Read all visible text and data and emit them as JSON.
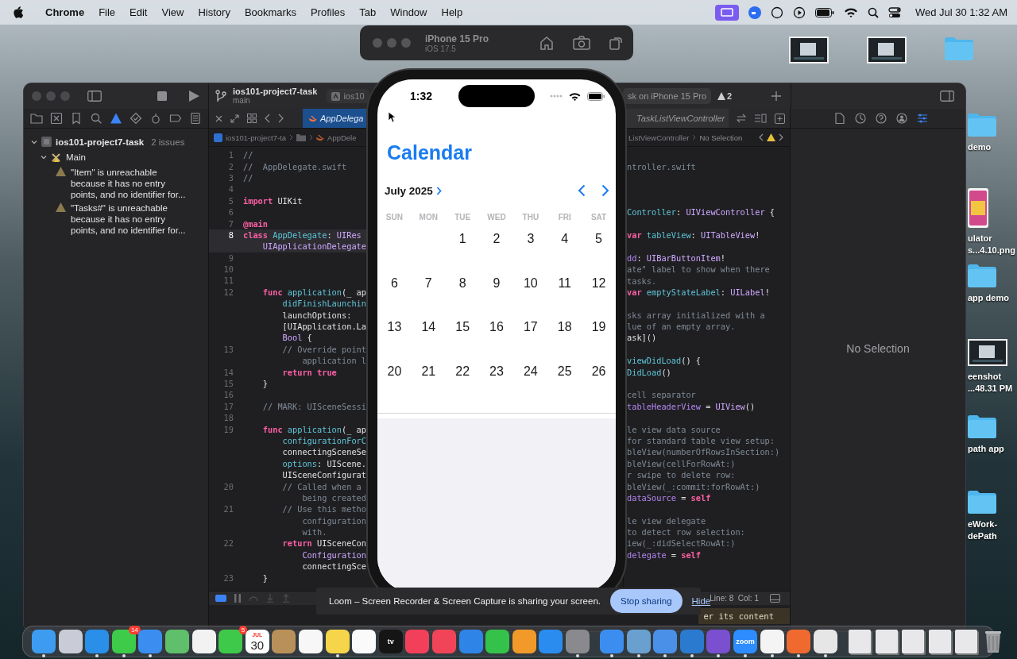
{
  "menu_bar": {
    "app_name": "Chrome",
    "menus": [
      "File",
      "Edit",
      "View",
      "History",
      "Bookmarks",
      "Profiles",
      "Tab",
      "Window",
      "Help"
    ],
    "clock": "Wed Jul 30 1:32 AM"
  },
  "simulator_toolbar": {
    "device": "iPhone 15 Pro",
    "os": "iOS 17.5"
  },
  "desktop_top_row": [
    {
      "kind": "screenshot"
    },
    {
      "kind": "screenshot"
    },
    {
      "kind": "folder"
    }
  ],
  "desktop_column": [
    {
      "kind": "folder",
      "label": "demo"
    },
    {
      "kind": "image",
      "label": "ulator\ns...4.10.png"
    },
    {
      "kind": "folder",
      "label": "app demo"
    },
    {
      "kind": "screenshot",
      "label": "eenshot\n...48.31 PM"
    },
    {
      "kind": "folder",
      "label": "path app"
    },
    {
      "kind": "folder",
      "label": "eWork-\ndePath"
    }
  ],
  "xcode": {
    "project": {
      "title": "ios101-project7-task",
      "branch": "main"
    },
    "scheme_fragment": "ios10",
    "destination_fragment": "sk on iPhone 15 Pro",
    "warning_count": "2",
    "navigator_tabs": [
      {
        "kind": "folder",
        "selected": false
      },
      {
        "kind": "source",
        "selected": false
      },
      {
        "kind": "bookmark",
        "selected": false
      },
      {
        "kind": "search",
        "selected": false
      },
      {
        "kind": "warning",
        "selected": true
      },
      {
        "kind": "test",
        "selected": false
      },
      {
        "kind": "debug",
        "selected": false
      },
      {
        "kind": "breakpoint",
        "selected": false
      },
      {
        "kind": "report",
        "selected": false
      }
    ],
    "issue_tree": {
      "project": "ios101-project7-task",
      "count": "2 issues",
      "expanded": true,
      "children": [
        {
          "name": "Main",
          "expanded": true,
          "children": [
            {
              "message": "\"Item\" is unreachable because it has no entry points, and no identifier for..."
            },
            {
              "message": "\"Tasks#\" is unreachable because it has no entry points, and no identifier for..."
            }
          ]
        }
      ]
    },
    "editor_tabs": [
      {
        "title": "AppDelega",
        "selected": true
      },
      {
        "title": "TaskListViewController",
        "selected": false
      }
    ],
    "left_breadcrumb": [
      "ios101-project7-ta",
      "AppDele"
    ],
    "right_breadcrumb": [
      "ListViewController",
      "No Selection"
    ],
    "left_code": [
      {
        "number": "1",
        "current": false,
        "segments": [
          {
            "kind": "comment",
            "text": "//"
          }
        ]
      },
      {
        "number": "2",
        "current": false,
        "segments": [
          {
            "kind": "comment",
            "text": "//  AppDelegate.swift"
          }
        ]
      },
      {
        "number": "3",
        "current": false,
        "segments": [
          {
            "kind": "comment",
            "text": "//"
          }
        ]
      },
      {
        "number": "4",
        "current": false
      },
      {
        "number": "5",
        "current": false,
        "segments": [
          {
            "kind": "keyword",
            "text": "import"
          },
          {
            "kind": "plain",
            "text": " UIKit"
          }
        ]
      },
      {
        "number": "6",
        "current": false
      },
      {
        "number": "7",
        "current": false,
        "segments": [
          {
            "kind": "keyword",
            "text": "@main"
          }
        ]
      },
      {
        "number": "8",
        "current": true,
        "segments": [
          {
            "kind": "keyword",
            "text": "class"
          },
          {
            "kind": "name",
            "text": " AppDelegate"
          },
          {
            "kind": "plain",
            "text": ": "
          },
          {
            "kind": "type",
            "text": "UIRes"
          }
        ]
      },
      {
        "current": true,
        "segments": [
          {
            "kind": "type",
            "text": "    UIApplicationDelegate"
          }
        ]
      },
      {
        "number": "9",
        "current": false
      },
      {
        "number": "10",
        "current": false
      },
      {
        "number": "11",
        "current": false
      },
      {
        "number": "12",
        "current": false,
        "segments": [
          {
            "kind": "keyword",
            "text": "    func"
          },
          {
            "kind": "name",
            "text": " application"
          },
          {
            "kind": "plain",
            "text": "(_ ap"
          }
        ]
      },
      {
        "current": false,
        "segments": [
          {
            "kind": "name",
            "text": "        didFinishLaunchin"
          }
        ]
      },
      {
        "current": false,
        "segments": [
          {
            "kind": "plain",
            "text": "        launchOptions:"
          }
        ]
      },
      {
        "current": false,
        "segments": [
          {
            "kind": "plain",
            "text": "        [UIApplication.La"
          }
        ]
      },
      {
        "current": false,
        "segments": [
          {
            "kind": "type",
            "text": "        Bool"
          },
          {
            "kind": "plain",
            "text": " {"
          }
        ]
      },
      {
        "number": "13",
        "current": false,
        "segments": [
          {
            "kind": "comment",
            "text": "        // Override point"
          }
        ]
      },
      {
        "current": false,
        "segments": [
          {
            "kind": "comment",
            "text": "            application l"
          }
        ]
      },
      {
        "number": "14",
        "current": false,
        "segments": [
          {
            "kind": "keyword",
            "text": "        return true"
          }
        ]
      },
      {
        "number": "15",
        "current": false,
        "segments": [
          {
            "kind": "plain",
            "text": "    }"
          }
        ]
      },
      {
        "number": "16",
        "current": false
      },
      {
        "number": "17",
        "current": false,
        "segments": [
          {
            "kind": "comment",
            "text": "    // MARK: UISceneSessi"
          }
        ]
      },
      {
        "number": "18",
        "current": false
      },
      {
        "number": "19",
        "current": false,
        "segments": [
          {
            "kind": "keyword",
            "text": "    func"
          },
          {
            "kind": "name",
            "text": " application"
          },
          {
            "kind": "plain",
            "text": "(_ ap"
          }
        ]
      },
      {
        "current": false,
        "segments": [
          {
            "kind": "name",
            "text": "        configurationForC"
          }
        ]
      },
      {
        "current": false,
        "segments": [
          {
            "kind": "plain",
            "text": "        connectingSceneSe"
          }
        ]
      },
      {
        "current": false,
        "segments": [
          {
            "kind": "name",
            "text": "        options"
          },
          {
            "kind": "plain",
            "text": ": UIScene."
          }
        ]
      },
      {
        "current": false,
        "segments": [
          {
            "kind": "plain",
            "text": "        UISceneConfigurat"
          }
        ]
      },
      {
        "number": "20",
        "current": false,
        "segments": [
          {
            "kind": "comment",
            "text": "        // Called when a"
          }
        ]
      },
      {
        "current": false,
        "segments": [
          {
            "kind": "comment",
            "text": "            being created"
          }
        ]
      },
      {
        "number": "21",
        "current": false,
        "segments": [
          {
            "kind": "comment",
            "text": "        // Use this metho"
          }
        ]
      },
      {
        "current": false,
        "segments": [
          {
            "kind": "comment",
            "text": "            configuration"
          }
        ]
      },
      {
        "current": false,
        "segments": [
          {
            "kind": "comment",
            "text": "            with."
          }
        ]
      },
      {
        "number": "22",
        "current": false,
        "segments": [
          {
            "kind": "keyword",
            "text": "        return"
          },
          {
            "kind": "plain",
            "text": " UISceneCon"
          }
        ]
      },
      {
        "current": false,
        "segments": [
          {
            "kind": "type",
            "text": "            Configuration"
          }
        ]
      },
      {
        "current": false,
        "segments": [
          {
            "kind": "plain",
            "text": "            connectingSce"
          }
        ]
      },
      {
        "number": "23",
        "current": false,
        "segments": [
          {
            "kind": "plain",
            "text": "    }"
          }
        ]
      }
    ],
    "right_code": [
      {
        "kind": "header",
        "lines": [
          {
            "segments": [
              {
                "kind": "comment",
                "text": "ntroller.swift"
              }
            ]
          }
        ]
      },
      {
        "kind": "body",
        "lines": [
          {
            "segments": [
              {
                "kind": "name",
                "text": "Controller"
              },
              {
                "kind": "plain",
                "text": ": "
              },
              {
                "kind": "type",
                "text": "UIViewController"
              },
              {
                "kind": "plain",
                "text": " {"
              }
            ]
          }
        ]
      },
      {
        "kind": "body",
        "lines": [
          {
            "segments": [
              {
                "kind": "keyword",
                "text": "var"
              },
              {
                "kind": "name",
                "text": " tableView"
              },
              {
                "kind": "plain",
                "text": ": "
              },
              {
                "kind": "type",
                "text": "UITableView"
              },
              {
                "kind": "plain",
                "text": "!"
              }
            ]
          }
        ]
      },
      {
        "kind": "body",
        "lines": [
          {
            "segments": [
              {
                "kind": "property",
                "text": "dd"
              },
              {
                "kind": "plain",
                "text": ": "
              },
              {
                "kind": "type",
                "text": "UIBarButtonItem"
              },
              {
                "kind": "plain",
                "text": "!"
              }
            ]
          },
          {
            "segments": [
              {
                "kind": "comment",
                "text": "ate\" label to show when there"
              }
            ]
          },
          {
            "segments": [
              {
                "kind": "comment",
                "text": "tasks."
              }
            ]
          },
          {
            "segments": [
              {
                "kind": "keyword",
                "text": "var"
              },
              {
                "kind": "name",
                "text": " emptyStateLabel"
              },
              {
                "kind": "plain",
                "text": ": "
              },
              {
                "kind": "type",
                "text": "UILabel"
              },
              {
                "kind": "plain",
                "text": "!"
              }
            ]
          }
        ]
      },
      {
        "kind": "body",
        "lines": [
          {
            "segments": [
              {
                "kind": "comment",
                "text": "sks array initialized with a"
              }
            ]
          },
          {
            "segments": [
              {
                "kind": "comment",
                "text": "lue of an empty array."
              }
            ]
          },
          {
            "segments": [
              {
                "kind": "plain",
                "text": "ask]()"
              }
            ]
          }
        ]
      },
      {
        "kind": "body",
        "lines": [
          {
            "segments": [
              {
                "kind": "name",
                "text": "viewDidLoad"
              },
              {
                "kind": "plain",
                "text": "() {"
              }
            ]
          },
          {
            "segments": [
              {
                "kind": "name",
                "text": "DidLoad"
              },
              {
                "kind": "plain",
                "text": "()"
              }
            ]
          }
        ]
      },
      {
        "kind": "body",
        "lines": [
          {
            "segments": [
              {
                "kind": "comment",
                "text": "cell separator"
              }
            ]
          },
          {
            "segments": [
              {
                "kind": "property",
                "text": "tableHeaderView"
              },
              {
                "kind": "plain",
                "text": " = "
              },
              {
                "kind": "type",
                "text": "UIView"
              },
              {
                "kind": "plain",
                "text": "()"
              }
            ]
          }
        ]
      },
      {
        "kind": "body",
        "lines": [
          {
            "segments": [
              {
                "kind": "comment",
                "text": "le view data source"
              }
            ]
          },
          {
            "segments": [
              {
                "kind": "comment",
                "text": "for standard table view setup:"
              }
            ]
          },
          {
            "segments": [
              {
                "kind": "comment",
                "text": "bleView(numberOfRowsInSection:)"
              }
            ]
          },
          {
            "segments": [
              {
                "kind": "comment",
                "text": "bleView(cellForRowAt:)"
              }
            ]
          },
          {
            "segments": [
              {
                "kind": "comment",
                "text": "r swipe to delete row:"
              }
            ]
          },
          {
            "segments": [
              {
                "kind": "comment",
                "text": "bleView(_:commit:forRowAt:)"
              }
            ]
          },
          {
            "segments": [
              {
                "kind": "property",
                "text": "dataSource"
              },
              {
                "kind": "plain",
                "text": " = "
              },
              {
                "kind": "keyword",
                "text": "self"
              }
            ]
          }
        ]
      },
      {
        "kind": "body",
        "lines": [
          {
            "segments": [
              {
                "kind": "comment",
                "text": "le view delegate"
              }
            ]
          },
          {
            "segments": [
              {
                "kind": "comment",
                "text": "to detect row selection:"
              }
            ]
          },
          {
            "segments": [
              {
                "kind": "comment",
                "text": "iew(_:didSelectRowAt:)"
              }
            ]
          },
          {
            "segments": [
              {
                "kind": "property",
                "text": "delegate"
              },
              {
                "kind": "plain",
                "text": " = "
              },
              {
                "kind": "keyword",
                "text": "self"
              }
            ]
          }
        ]
      }
    ],
    "inspector": {
      "tabs": [
        {
          "kind": "file",
          "selected": false
        },
        {
          "kind": "history",
          "selected": false
        },
        {
          "kind": "help",
          "selected": false
        },
        {
          "kind": "identity",
          "selected": false
        },
        {
          "kind": "attributes",
          "selected": true
        }
      ],
      "empty_text": "No Selection"
    },
    "cursor_position": "Line: 8  Col: 1",
    "console_fragment": "er its content"
  },
  "phone": {
    "status_time": "1:32",
    "title": "Calendar",
    "month_label": "July 2025",
    "weekdays": [
      "SUN",
      "MON",
      "TUE",
      "WED",
      "THU",
      "FRI",
      "SAT"
    ],
    "weeks": [
      {
        "kind": "partial",
        "days": [
          "1",
          "2",
          "3",
          "4",
          "5"
        ]
      },
      {
        "kind": "full",
        "days": [
          "6",
          "7",
          "8",
          "9",
          "10",
          "11",
          "12"
        ]
      },
      {
        "kind": "full",
        "days": [
          "13",
          "14",
          "15",
          "16",
          "17",
          "18",
          "19"
        ]
      },
      {
        "kind": "full",
        "days": [
          "20",
          "21",
          "22",
          "23",
          "24",
          "25",
          "26"
        ]
      }
    ]
  },
  "loom_bar": {
    "message": "Loom – Screen Recorder & Screen Capture is sharing your screen.",
    "stop_button": "Stop sharing",
    "hide_link": "Hide"
  },
  "dock": {
    "items": [
      {
        "kind": "app",
        "color": "#3d9cf0",
        "running": true
      },
      {
        "kind": "app",
        "color": "#c9ccd6",
        "running": false
      },
      {
        "kind": "app",
        "color": "#2a8fe8",
        "running": true
      },
      {
        "kind": "app",
        "color": "#3ecb4a",
        "badge": "14",
        "running": true
      },
      {
        "kind": "app",
        "color": "#3b8ef0",
        "running": true
      },
      {
        "kind": "app",
        "color": "#5fbf6a",
        "running": false
      },
      {
        "kind": "app",
        "color": "#f2f2f2",
        "running": false
      },
      {
        "kind": "app",
        "color": "#3ec94a",
        "badge": "5",
        "running": false
      },
      {
        "kind": "calendar",
        "month": "JUL",
        "day": "30",
        "running": false
      },
      {
        "kind": "app",
        "color": "#b8905a",
        "running": false
      },
      {
        "kind": "app",
        "color": "#f7f7f7",
        "running": false
      },
      {
        "kind": "app",
        "color": "#f6d54a",
        "running": true
      },
      {
        "kind": "app",
        "color": "#fafafa",
        "running": false
      },
      {
        "kind": "app",
        "color": "#151515",
        "label": "tv",
        "running": false
      },
      {
        "kind": "app",
        "color": "#f2405a",
        "running": false
      },
      {
        "kind": "app",
        "color": "#f24459",
        "running": false
      },
      {
        "kind": "app",
        "color": "#2f84e8",
        "running": false
      },
      {
        "kind": "app",
        "color": "#35c24a",
        "running": false
      },
      {
        "kind": "app",
        "color": "#f19a2a",
        "running": false
      },
      {
        "kind": "app",
        "color": "#2b8cf0",
        "running": false
      },
      {
        "kind": "app",
        "color": "#8a8a8e",
        "running": true
      },
      {
        "kind": "divider"
      },
      {
        "kind": "app",
        "color": "#3b8ef0",
        "running": true
      },
      {
        "kind": "app",
        "color": "#6aa0d0",
        "running": true
      },
      {
        "kind": "app",
        "color": "#4a90e8",
        "running": true
      },
      {
        "kind": "app",
        "color": "#2a7ad0",
        "running": true
      },
      {
        "kind": "app",
        "color": "#7a4fd0",
        "running": true
      },
      {
        "kind": "app",
        "color": "#2d8cff",
        "label": "zoom",
        "running": true
      },
      {
        "kind": "app",
        "color": "#f4f4f4",
        "running": true
      },
      {
        "kind": "app",
        "color": "#f06a30",
        "running": true
      },
      {
        "kind": "app",
        "color": "#e6e6e6",
        "running": true
      },
      {
        "kind": "divider"
      },
      {
        "kind": "stack"
      },
      {
        "kind": "stack"
      },
      {
        "kind": "stack"
      },
      {
        "kind": "stack"
      },
      {
        "kind": "stack"
      },
      {
        "kind": "trash"
      }
    ]
  }
}
